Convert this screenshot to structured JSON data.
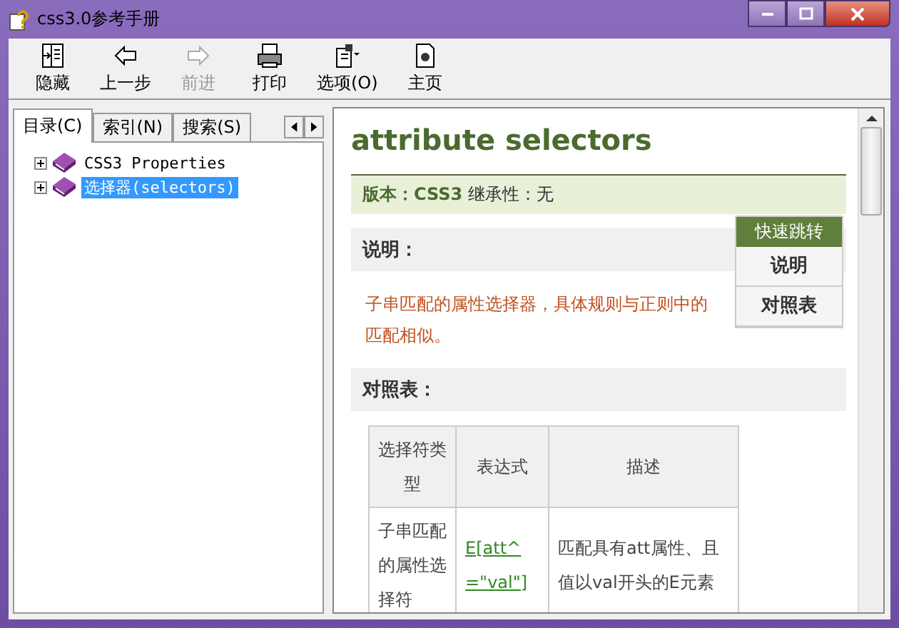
{
  "window": {
    "title": "css3.0参考手册"
  },
  "toolbar": [
    {
      "label": "隐藏",
      "kind": "hide",
      "disabled": false
    },
    {
      "label": "上一步",
      "kind": "back",
      "disabled": false
    },
    {
      "label": "前进",
      "kind": "forward",
      "disabled": true
    },
    {
      "label": "打印",
      "kind": "print",
      "disabled": false
    },
    {
      "label": "选项(O)",
      "kind": "options",
      "disabled": false
    },
    {
      "label": "主页",
      "kind": "home",
      "disabled": false
    }
  ],
  "nav_tabs": [
    {
      "label": "目录(C)",
      "selected": true
    },
    {
      "label": "索引(N)",
      "selected": false
    },
    {
      "label": "搜索(S)",
      "selected": false
    }
  ],
  "tree": [
    {
      "label": "CSS3 Properties",
      "expanded": false,
      "selected": false
    },
    {
      "label": "选择器(selectors)",
      "expanded": false,
      "selected": true
    }
  ],
  "content": {
    "heading": "attribute selectors",
    "meta": "**版本：CSS3** 继承性：无",
    "quick_jump": {
      "title": "快速跳转",
      "links": [
        "说明",
        "对照表"
      ]
    },
    "sections": [
      {
        "title": "说明：",
        "text": "子串匹配的属性选择器，具体规则与正则中的匹配相似。"
      },
      {
        "title": "对照表："
      }
    ],
    "table": {
      "columns": [
        "选择符类型",
        "表达式",
        "描述"
      ],
      "rows": [
        [
          "子串匹配的属性选择符",
          "E[att^=\"val\"]",
          "匹配具有att属性、且值以val开头的E元素"
        ]
      ]
    }
  }
}
